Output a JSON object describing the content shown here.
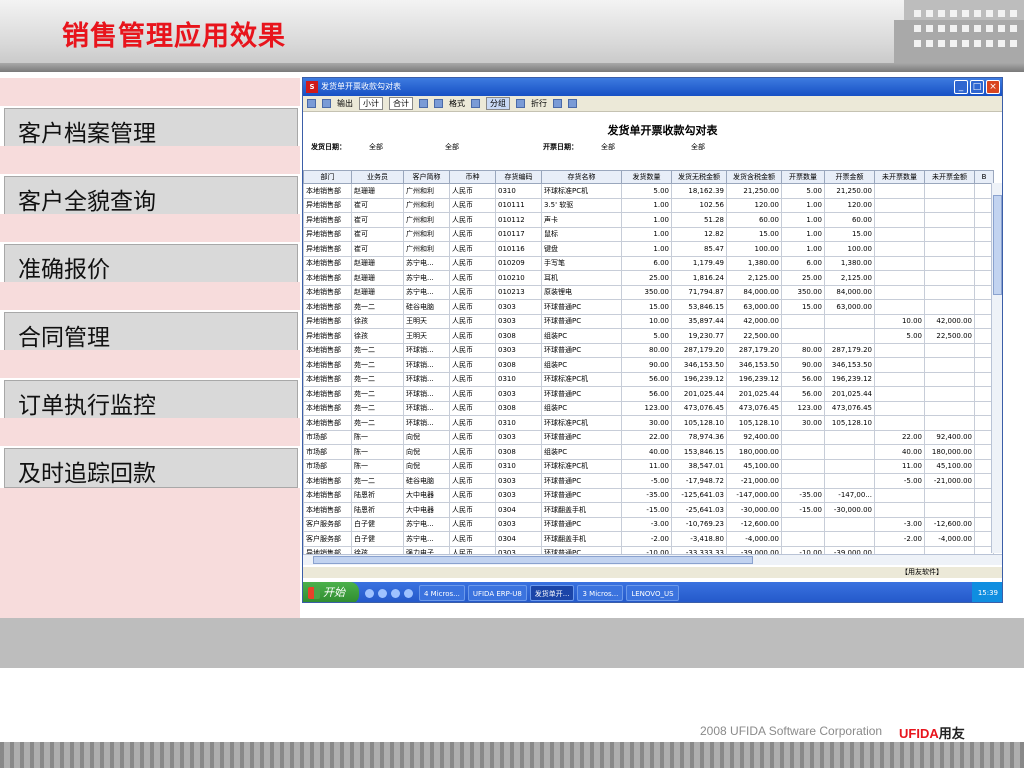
{
  "slide": {
    "title": "销售管理应用效果",
    "footer": "2008 UFIDA Software Corporation",
    "brand_en": "UFIDA",
    "brand_cn": "用友"
  },
  "menu": [
    {
      "label": "客户档案管理"
    },
    {
      "label": "客户全貌查询"
    },
    {
      "label": "准确报价"
    },
    {
      "label": "合同管理"
    },
    {
      "label": "订单执行监控"
    },
    {
      "label": "及时追踪回款"
    }
  ],
  "window": {
    "title": "发货单开票收款勾对表",
    "logo": "S",
    "toolbar": [
      "输出",
      "小计",
      "合计",
      "格式",
      "分组",
      "折行"
    ],
    "report_title": "发货单开票收款勾对表",
    "filters": {
      "ship_date_label": "发货日期：",
      "ship_date_from": "全部",
      "ship_date_to": "全部",
      "inv_date_label": "开票日期：",
      "inv_date_from": "全部",
      "inv_date_to": "全部"
    },
    "columns": [
      "部门",
      "业务员",
      "客户简称",
      "币种",
      "存货编码",
      "存货名称",
      "发货数量",
      "发货无税金额",
      "发货含税金额",
      "开票数量",
      "开票金额",
      "未开票数量",
      "未开票金额",
      "B"
    ],
    "rows": [
      [
        "本地销售部",
        "赵珊珊",
        "广州和利",
        "人民币",
        "0310",
        "环球标准PC机",
        "5.00",
        "18,162.39",
        "21,250.00",
        "5.00",
        "21,250.00",
        "",
        ""
      ],
      [
        "异地销售部",
        "崔可",
        "广州和利",
        "人民币",
        "010111",
        "3.5' 软驱",
        "1.00",
        "102.56",
        "120.00",
        "1.00",
        "120.00",
        "",
        ""
      ],
      [
        "异地销售部",
        "崔可",
        "广州和利",
        "人民币",
        "010112",
        "声卡",
        "1.00",
        "51.28",
        "60.00",
        "1.00",
        "60.00",
        "",
        ""
      ],
      [
        "异地销售部",
        "崔可",
        "广州和利",
        "人民币",
        "010117",
        "鼠标",
        "1.00",
        "12.82",
        "15.00",
        "1.00",
        "15.00",
        "",
        ""
      ],
      [
        "异地销售部",
        "崔可",
        "广州和利",
        "人民币",
        "010116",
        "键盘",
        "1.00",
        "85.47",
        "100.00",
        "1.00",
        "100.00",
        "",
        ""
      ],
      [
        "本地销售部",
        "赵珊珊",
        "苏宁电...",
        "人民币",
        "010209",
        "手写笔",
        "6.00",
        "1,179.49",
        "1,380.00",
        "6.00",
        "1,380.00",
        "",
        ""
      ],
      [
        "本地销售部",
        "赵珊珊",
        "苏宁电...",
        "人民币",
        "010210",
        "耳机",
        "25.00",
        "1,816.24",
        "2,125.00",
        "25.00",
        "2,125.00",
        "",
        ""
      ],
      [
        "本地销售部",
        "赵珊珊",
        "苏宁电...",
        "人民币",
        "010213",
        "原装锂电",
        "350.00",
        "71,794.87",
        "84,000.00",
        "350.00",
        "84,000.00",
        "",
        ""
      ],
      [
        "本地销售部",
        "苑一二",
        "硅谷电脑",
        "人民币",
        "0303",
        "环球普通PC",
        "15.00",
        "53,846.15",
        "63,000.00",
        "15.00",
        "63,000.00",
        "",
        ""
      ],
      [
        "异地销售部",
        "徐孩",
        "王明天",
        "人民币",
        "0303",
        "环球普通PC",
        "10.00",
        "35,897.44",
        "42,000.00",
        "",
        "",
        "10.00",
        "42,000.00"
      ],
      [
        "异地销售部",
        "徐孩",
        "王明天",
        "人民币",
        "0308",
        "组装PC",
        "5.00",
        "19,230.77",
        "22,500.00",
        "",
        "",
        "5.00",
        "22,500.00"
      ],
      [
        "本地销售部",
        "苑一二",
        "环球销...",
        "人民币",
        "0303",
        "环球普通PC",
        "80.00",
        "287,179.20",
        "287,179.20",
        "80.00",
        "287,179.20",
        "",
        ""
      ],
      [
        "本地销售部",
        "苑一二",
        "环球销...",
        "人民币",
        "0308",
        "组装PC",
        "90.00",
        "346,153.50",
        "346,153.50",
        "90.00",
        "346,153.50",
        "",
        ""
      ],
      [
        "本地销售部",
        "苑一二",
        "环球销...",
        "人民币",
        "0310",
        "环球标准PC机",
        "56.00",
        "196,239.12",
        "196,239.12",
        "56.00",
        "196,239.12",
        "",
        ""
      ],
      [
        "本地销售部",
        "苑一二",
        "环球销...",
        "人民币",
        "0303",
        "环球普通PC",
        "56.00",
        "201,025.44",
        "201,025.44",
        "56.00",
        "201,025.44",
        "",
        ""
      ],
      [
        "本地销售部",
        "苑一二",
        "环球销...",
        "人民币",
        "0308",
        "组装PC",
        "123.00",
        "473,076.45",
        "473,076.45",
        "123.00",
        "473,076.45",
        "",
        ""
      ],
      [
        "本地销售部",
        "苑一二",
        "环球销...",
        "人民币",
        "0310",
        "环球标准PC机",
        "30.00",
        "105,128.10",
        "105,128.10",
        "30.00",
        "105,128.10",
        "",
        ""
      ],
      [
        "市场部",
        "陈一",
        "向倪",
        "人民币",
        "0303",
        "环球普通PC",
        "22.00",
        "78,974.36",
        "92,400.00",
        "",
        "",
        "22.00",
        "92,400.00"
      ],
      [
        "市场部",
        "陈一",
        "向倪",
        "人民币",
        "0308",
        "组装PC",
        "40.00",
        "153,846.15",
        "180,000.00",
        "",
        "",
        "40.00",
        "180,000.00"
      ],
      [
        "市场部",
        "陈一",
        "向倪",
        "人民币",
        "0310",
        "环球标准PC机",
        "11.00",
        "38,547.01",
        "45,100.00",
        "",
        "",
        "11.00",
        "45,100.00"
      ],
      [
        "本地销售部",
        "苑一二",
        "硅谷电脑",
        "人民币",
        "0303",
        "环球普通PC",
        "-5.00",
        "-17,948.72",
        "-21,000.00",
        "",
        "",
        "-5.00",
        "-21,000.00"
      ],
      [
        "本地销售部",
        "陆恩祈",
        "大中电器",
        "人民币",
        "0303",
        "环球普通PC",
        "-35.00",
        "-125,641.03",
        "-147,000.00",
        "-35.00",
        "-147,00...",
        "",
        ""
      ],
      [
        "本地销售部",
        "陆恩祈",
        "大中电器",
        "人民币",
        "0304",
        "环球翻盖手机",
        "-15.00",
        "-25,641.03",
        "-30,000.00",
        "-15.00",
        "-30,000.00",
        "",
        ""
      ],
      [
        "客户服务部",
        "白子健",
        "苏宁电...",
        "人民币",
        "0303",
        "环球普通PC",
        "-3.00",
        "-10,769.23",
        "-12,600.00",
        "",
        "",
        "-3.00",
        "-12,600.00"
      ],
      [
        "客户服务部",
        "白子健",
        "苏宁电...",
        "人民币",
        "0304",
        "环球翻盖手机",
        "-2.00",
        "-3,418.80",
        "-4,000.00",
        "",
        "",
        "-2.00",
        "-4,000.00"
      ],
      [
        "异地销售部",
        "徐孩",
        "强力电子",
        "人民币",
        "0303",
        "环球普通PC",
        "-10.00",
        "-33,333.33",
        "-39,000.00",
        "-10.00",
        "-39,000.00",
        "",
        ""
      ]
    ],
    "status": "【用友软件】"
  },
  "taskbar": {
    "start": "开始",
    "tasks": [
      "4 Micros...",
      "UFIDA ERP-U8",
      "发货单开...",
      "3 Micros...",
      "LENOVO_US"
    ],
    "active_task_index": 2,
    "clock": "15:39"
  },
  "colors": {
    "title_red": "#e8141c",
    "menu_pink": "#f7dcdc",
    "menu_gray": "#d9d9d9",
    "xp_blue": "#2257c8"
  }
}
